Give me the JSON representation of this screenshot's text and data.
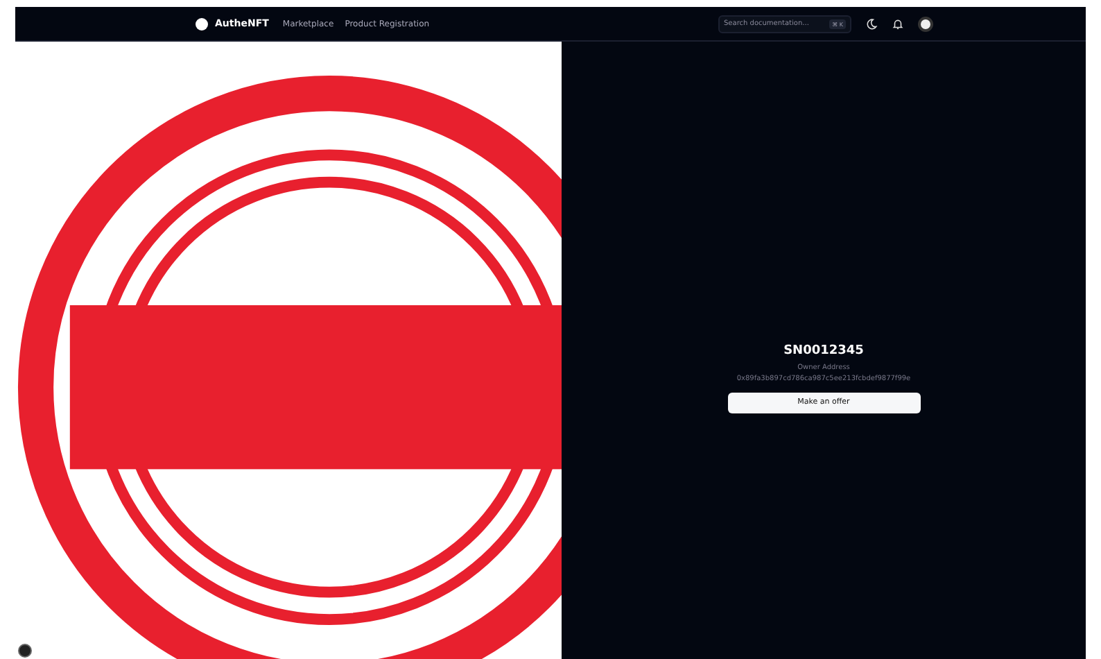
{
  "header": {
    "brand": "AutheNFT",
    "nav": [
      {
        "label": "Marketplace"
      },
      {
        "label": "Product Registration"
      }
    ],
    "search": {
      "placeholder": "Search documentation...",
      "shortcut": "⌘ K"
    }
  },
  "product": {
    "serial": "SN0012345",
    "owner_label": "Owner Address",
    "owner_address": "0x89fa3b897cd786ca987c5ee213fcbdef9877f99e",
    "button": "Make an offer"
  }
}
